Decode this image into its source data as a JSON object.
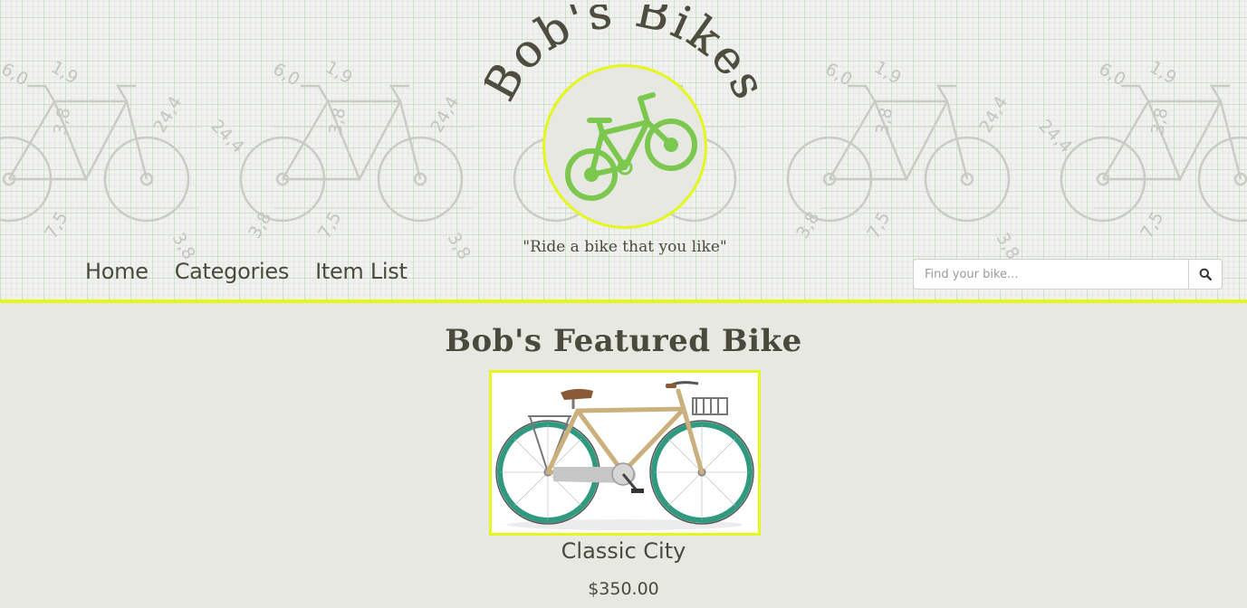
{
  "brand": {
    "logo_text": "Bob's Bikes",
    "tagline": "\"Ride a bike that you like\""
  },
  "nav": {
    "items": [
      {
        "label": "Home"
      },
      {
        "label": "Categories"
      },
      {
        "label": "Item List"
      }
    ]
  },
  "search": {
    "placeholder": "Find your bike...",
    "value": "",
    "button_icon": "search-icon"
  },
  "header_pattern_labels": [
    "6,0",
    "1,9",
    "3,8",
    "24,4",
    "7,5",
    "3,8"
  ],
  "featured": {
    "heading": "Bob's Featured Bike",
    "bike": {
      "name": "Classic City",
      "price": "$350.00",
      "image_icon": "bike-photo"
    }
  },
  "colors": {
    "accent": "#e4f71d",
    "text": "#4a4a3c",
    "logo_bike": "#7cc84e",
    "background": "#e7e8e2"
  }
}
